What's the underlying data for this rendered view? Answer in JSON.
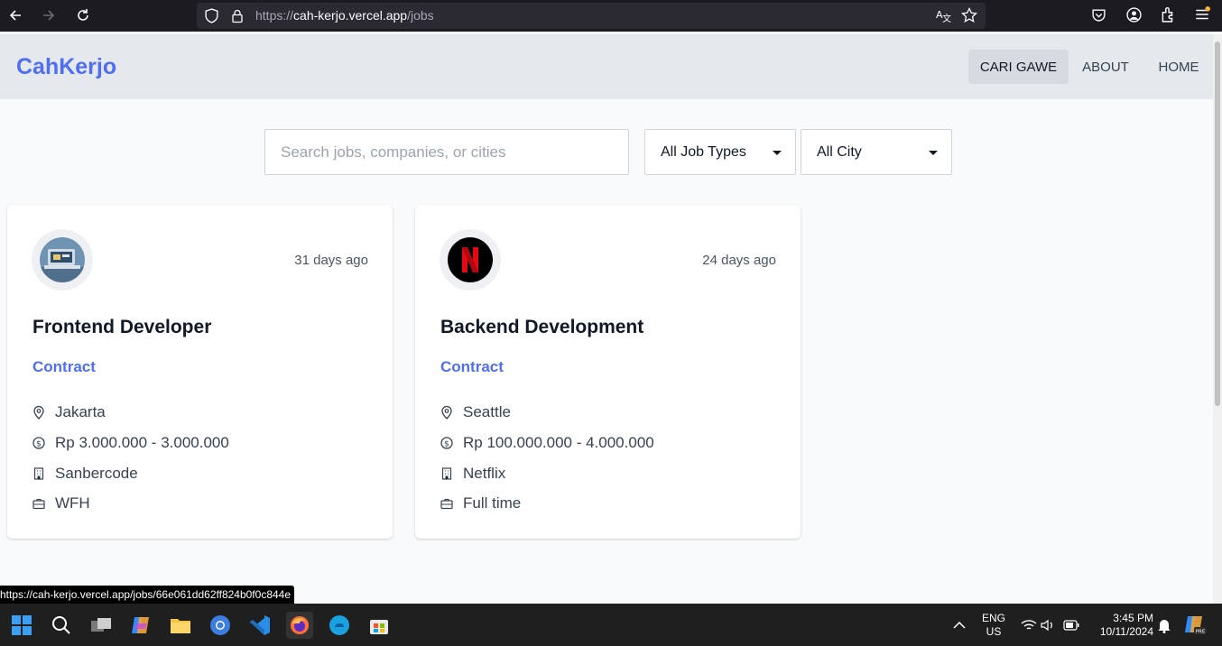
{
  "browser": {
    "url_host_prefix": "https://",
    "url_host": "cah-kerjo.vercel.app",
    "url_path": "/jobs"
  },
  "site": {
    "brand": "CahKerjo",
    "nav": [
      {
        "label": "CARI GAWE",
        "active": true
      },
      {
        "label": "ABOUT",
        "active": false
      },
      {
        "label": "HOME",
        "active": false
      }
    ]
  },
  "filters": {
    "search_placeholder": "Search jobs, companies, or cities",
    "job_type": "All Job Types",
    "city": "All City"
  },
  "jobs": [
    {
      "posted": "31 days ago",
      "title": "Frontend Developer",
      "type": "Contract",
      "location": "Jakarta",
      "salary": "Rp 3.000.000 - 3.000.000",
      "company": "Sanbercode",
      "work_mode": "WFH",
      "logo": "sanbercode-logo"
    },
    {
      "posted": "24 days ago",
      "title": "Backend Development",
      "type": "Contract",
      "location": "Seattle",
      "salary": "Rp 100.000.000 - 4.000.000",
      "company": "Netflix",
      "work_mode": "Full time",
      "logo": "netflix-logo"
    }
  ],
  "status_link": "https://cah-kerjo.vercel.app/jobs/66e061dd62ff824b0f0c844e",
  "taskbar": {
    "lang": "ENG",
    "region": "US",
    "time": "3:45 PM",
    "date": "10/11/2024"
  },
  "colors": {
    "accent": "#4f6ef1",
    "header_bg": "#e5e9ee",
    "page_bg": "#f9fafb",
    "netflix_red": "#e50914"
  }
}
